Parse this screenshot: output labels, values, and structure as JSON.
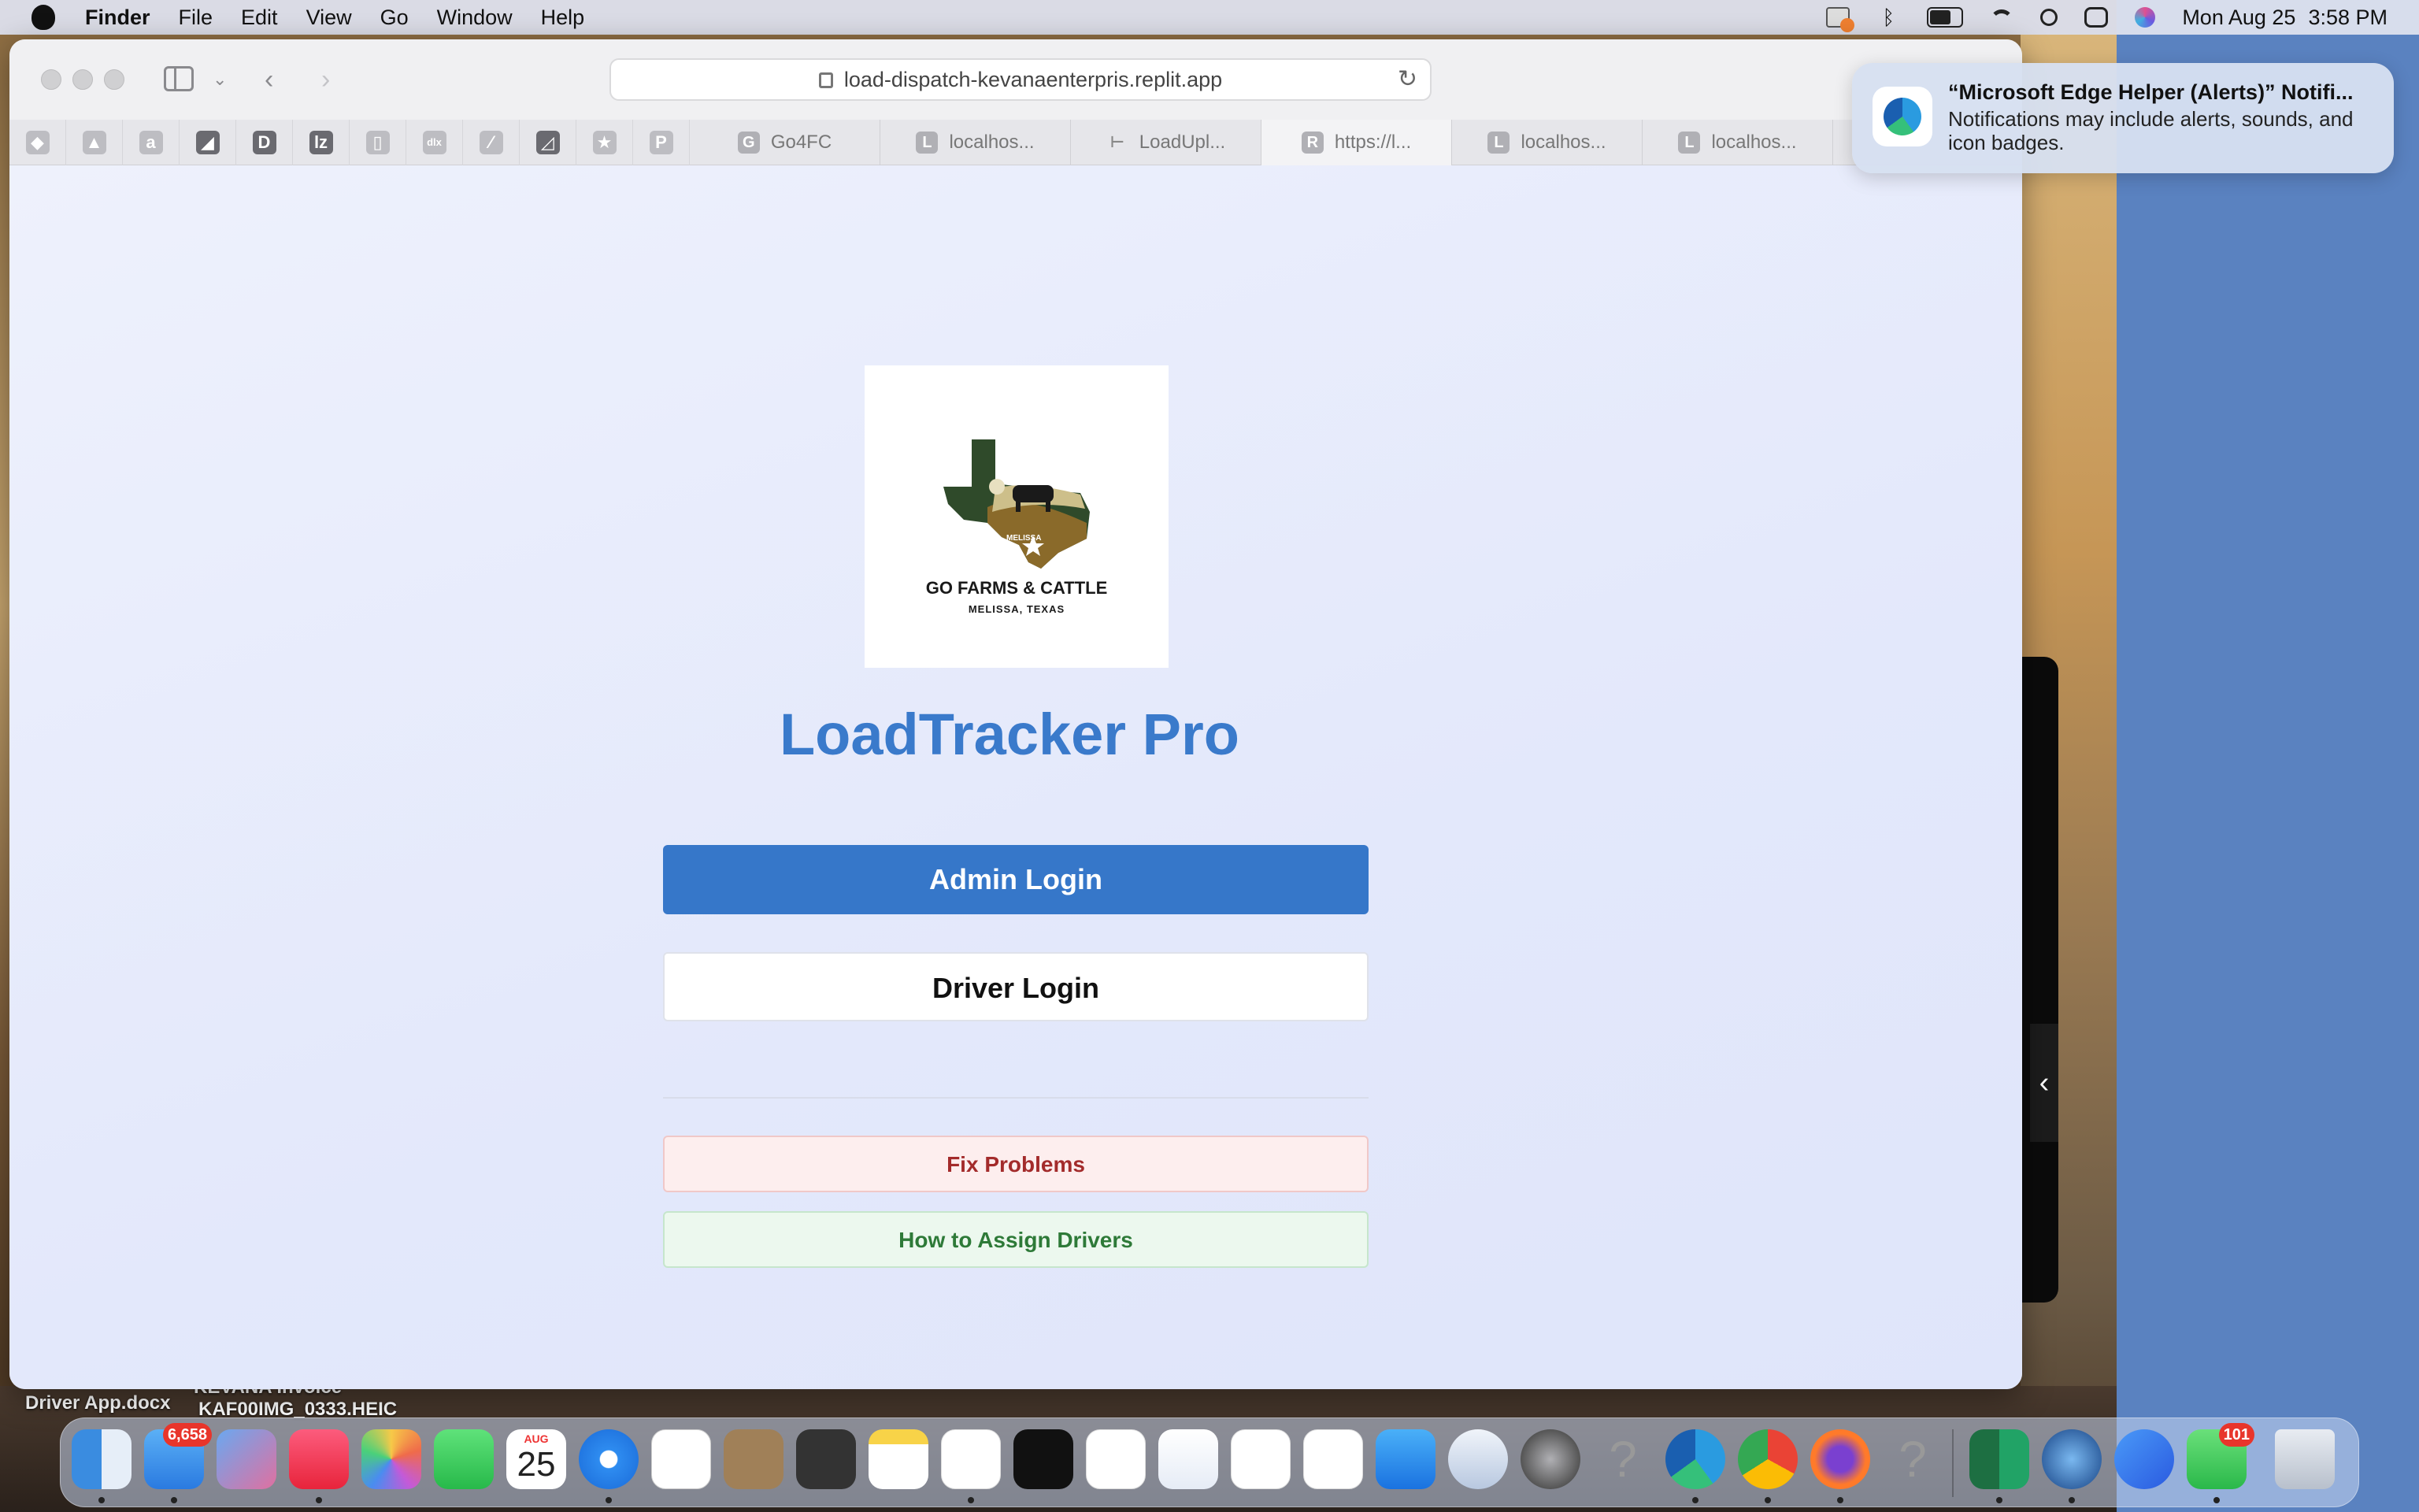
{
  "menubar": {
    "app_name": "Finder",
    "menus": [
      "File",
      "Edit",
      "View",
      "Go",
      "Window",
      "Help"
    ],
    "date": "Mon Aug 25",
    "time": "3:58 PM"
  },
  "desktop_files": [
    "Driver App.docx",
    "KEVANA Invoice",
    "KAF00IMG_0333.HEIC"
  ],
  "browser": {
    "url": "load-dispatch-kevanaenterpris.replit.app",
    "pinned_tabs": [
      "◆",
      "▲",
      "a",
      "◢",
      "D",
      "lz",
      "▯",
      "dlx",
      "⁄",
      "◿",
      "★",
      "P"
    ],
    "tabs": [
      {
        "favicon": "G",
        "label": "Go4FC"
      },
      {
        "favicon": "L",
        "label": "localhos..."
      },
      {
        "favicon": "⊢",
        "label": "LoadUpl..."
      },
      {
        "favicon": "R",
        "label": "https://l..."
      },
      {
        "favicon": "L",
        "label": "localhos..."
      },
      {
        "favicon": "L",
        "label": "localhos..."
      }
    ]
  },
  "page": {
    "logo": {
      "name": "GO FARMS & CATTLE",
      "location": "MELISSA, TEXAS",
      "badge": "MELISSA"
    },
    "title": "LoadTracker Pro",
    "admin_login": "Admin Login",
    "driver_login": "Driver Login",
    "fix_problems": "Fix Problems",
    "assign_drivers": "How to Assign Drivers"
  },
  "notification": {
    "title": "“Microsoft Edge Helper (Alerts)” Notifi...",
    "body": "Notifications may include alerts, sounds, and icon badges."
  },
  "dock": {
    "mail_badge": "6,658",
    "calendar_month": "AUG",
    "calendar_day": "25",
    "messages_badge": "101"
  },
  "colors": {
    "accent": "#3677c9",
    "title": "#3a7acb",
    "fix_text": "#a32b2b",
    "assign_text": "#2e7a38"
  }
}
